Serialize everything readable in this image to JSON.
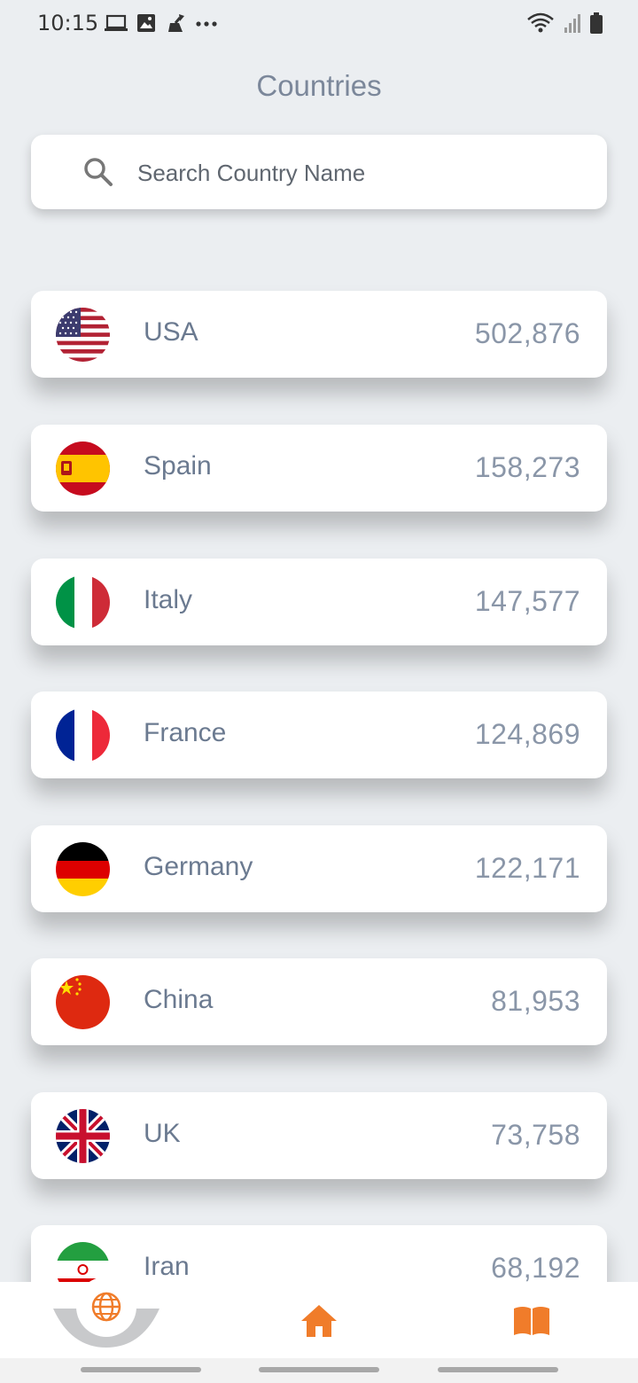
{
  "status_bar": {
    "time": "10:15",
    "left_icons": [
      "laptop-icon",
      "image-icon",
      "cleaner-icon",
      "more-dots-icon"
    ],
    "right_icons": [
      "wifi-icon",
      "signal-icon",
      "battery-icon"
    ]
  },
  "header": {
    "title": "Countries"
  },
  "search": {
    "placeholder": "Search Country Name",
    "value": ""
  },
  "countries": [
    {
      "name": "USA",
      "value": "502,876",
      "flag": "usa-flag-icon"
    },
    {
      "name": "Spain",
      "value": "158,273",
      "flag": "spain-flag-icon"
    },
    {
      "name": "Italy",
      "value": "147,577",
      "flag": "italy-flag-icon"
    },
    {
      "name": "France",
      "value": "124,869",
      "flag": "france-flag-icon"
    },
    {
      "name": "Germany",
      "value": "122,171",
      "flag": "germany-flag-icon"
    },
    {
      "name": "China",
      "value": "81,953",
      "flag": "china-flag-icon"
    },
    {
      "name": "UK",
      "value": "73,758",
      "flag": "uk-flag-icon"
    },
    {
      "name": "Iran",
      "value": "68,192",
      "flag": "iran-flag-icon"
    }
  ],
  "bottom_nav": {
    "items": [
      "globe-icon",
      "home-icon",
      "book-icon"
    ],
    "accent_color": "#f07c2a"
  },
  "colors": {
    "background": "#ebeef1",
    "card": "#ffffff",
    "text": "#6b7a90"
  }
}
